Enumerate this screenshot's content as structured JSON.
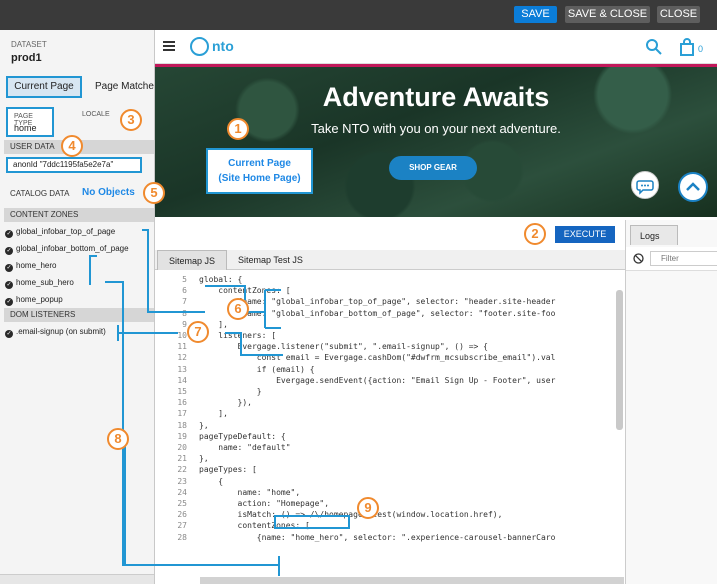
{
  "toolbar": {
    "save": "SAVE",
    "save_close": "SAVE & CLOSE",
    "close": "CLOSE"
  },
  "sidebar": {
    "dataset_label": "DATASET",
    "dataset_value": "prod1",
    "tabs": [
      "Current Page",
      "Page Matches"
    ],
    "page_type_label": "PAGE TYPE",
    "page_type_value": "home",
    "locale_label": "LOCALE",
    "user_data_header": "USER DATA",
    "anon_id": "anonId    \"7ddc1195fa5e2e7a\"",
    "catalog_label": "CATALOG DATA",
    "catalog_value": "No Objects",
    "content_zones_header": "CONTENT ZONES",
    "content_zones": [
      "global_infobar_top_of_page",
      "global_infobar_bottom_of_page",
      "home_hero",
      "home_sub_hero",
      "home_popup"
    ],
    "dom_listeners_header": "DOM LISTENERS",
    "dom_listeners": [
      ".email-signup (on submit)"
    ]
  },
  "preview": {
    "logo_text": "nto",
    "cart_count": "0",
    "hero_title": "Adventure Awaits",
    "hero_subtitle": "Take NTO with you on your next adventure.",
    "shop_button": "SHOP GEAR",
    "current_page_note": "Current Page\n(Site Home Page)"
  },
  "editor": {
    "execute": "EXECUTE",
    "tabs": [
      "Sitemap JS",
      "Sitemap Test JS"
    ],
    "lines": [
      {
        "n": "5",
        "t": "global: {"
      },
      {
        "n": "6",
        "t": "    contentZones: ["
      },
      {
        "n": "7",
        "t": "        {name: \"global_infobar_top_of_page\", selector: \"header.site-header"
      },
      {
        "n": "8",
        "t": "        {name: \"global_infobar_bottom_of_page\", selector: \"footer.site-foo"
      },
      {
        "n": "9",
        "t": "    ],"
      },
      {
        "n": "10",
        "t": "    listeners: ["
      },
      {
        "n": "11",
        "t": "        Evergage.listener(\"submit\", \".email-signup\", () => {"
      },
      {
        "n": "12",
        "t": "            const email = Evergage.cashDom(\"#dwfrm_mcsubscribe_email\").val"
      },
      {
        "n": "13",
        "t": "            if (email) {"
      },
      {
        "n": "14",
        "t": "                Evergage.sendEvent({action: \"Email Sign Up - Footer\", user"
      },
      {
        "n": "15",
        "t": "            }"
      },
      {
        "n": "16",
        "t": "        }),"
      },
      {
        "n": "17",
        "t": "    ],"
      },
      {
        "n": "18",
        "t": "},"
      },
      {
        "n": "19",
        "t": "pageTypeDefault: {"
      },
      {
        "n": "20",
        "t": "    name: \"default\""
      },
      {
        "n": "21",
        "t": "},"
      },
      {
        "n": "22",
        "t": "pageTypes: ["
      },
      {
        "n": "23",
        "t": "    {"
      },
      {
        "n": "24",
        "t": "        name: \"home\","
      },
      {
        "n": "25",
        "t": "        action: \"Homepage\","
      },
      {
        "n": "26",
        "t": "        isMatch: () => /\\/homepage/.test(window.location.href),"
      },
      {
        "n": "27",
        "t": "        contentZones: ["
      },
      {
        "n": "28",
        "t": "            {name: \"home_hero\", selector: \".experience-carousel-bannerCaro"
      }
    ]
  },
  "logs": {
    "tab": "Logs",
    "filter_placeholder": "Filter"
  },
  "annotations": [
    "1",
    "2",
    "3",
    "4",
    "5",
    "6",
    "7",
    "8",
    "9"
  ],
  "colors": {
    "accent_blue": "#2196d3",
    "annotation_orange": "#f08a2e",
    "toolbar_bg": "#3a3a3a",
    "save_blue": "#0b7dd8"
  }
}
